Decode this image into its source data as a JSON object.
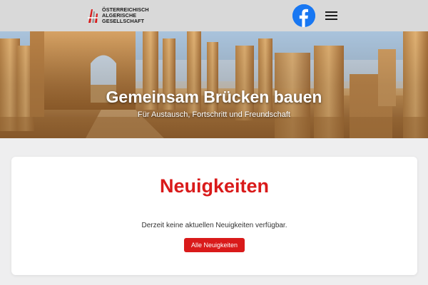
{
  "header": {
    "logo": {
      "lines": [
        "ÖSTERREICHISCH",
        "ALGERISCHE",
        "GESELLSCHAFT"
      ]
    },
    "facebook_icon": "facebook-icon",
    "menu_icon": "hamburger-menu-icon"
  },
  "hero": {
    "title": "Gemeinsam Brücken bauen",
    "subtitle": "Für Austausch, Fortschritt und Freundschaft"
  },
  "news": {
    "title": "Neuigkeiten",
    "empty_message": "Derzeit keine aktuellen Neuigkeiten verfügbar.",
    "button_label": "Alle Neuigkeiten"
  },
  "colors": {
    "accent_red": "#d91a1a",
    "header_bg": "#d9d9d9",
    "page_bg": "#eeeeef",
    "facebook_blue": "#1877f2"
  }
}
